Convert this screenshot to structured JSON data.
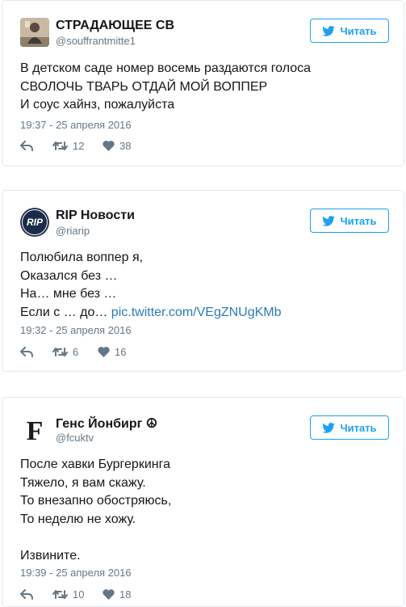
{
  "tweets": [
    {
      "name": "СТРАДАЮЩЕЕ СВ",
      "handle": "@souffrantmitte1",
      "follow_label": "Читать",
      "avatar_icon": "person-photo-avatar-icon",
      "lines": [
        "В детском саде номер восемь раздаются голоса",
        "СВОЛОЧЬ ТВАРЬ ОТДАЙ МОЙ ВОППЕР",
        "И соус хайнз, пожалуйста"
      ],
      "timestamp": "19:37 - 25 апреля 2016",
      "retweets": "12",
      "likes": "38"
    },
    {
      "name": "RIP Новости",
      "handle": "@riarip",
      "follow_label": "Читать",
      "avatar_icon": "rip-logo-avatar-icon",
      "lines": [
        "Полюбила воппер я,",
        "Оказался без …",
        "На… мне без …",
        "Если с … до…"
      ],
      "link": "pic.twitter.com/VEgZNUgKMb",
      "timestamp": "19:32 - 25 апреля 2016",
      "retweets": "6",
      "likes": "16"
    },
    {
      "name": "Генс Йонбирг ☮",
      "handle": "@fcuktv",
      "follow_label": "Читать",
      "avatar_icon": "letter-f-avatar-icon",
      "avatar_letter": "F",
      "lines": [
        "После хавки Бургеркинга",
        "Тяжело, я вам скажу.",
        "То внезапно обостряюсь,",
        "То неделю не хожу."
      ],
      "closing": "Извините.",
      "timestamp": "19:39 - 25 апреля 2016",
      "retweets": "10",
      "likes": "18"
    }
  ],
  "colors": {
    "accent": "#1da1f2",
    "link": "#2b7bb9",
    "muted": "#657786",
    "border": "#e1e8ed"
  }
}
